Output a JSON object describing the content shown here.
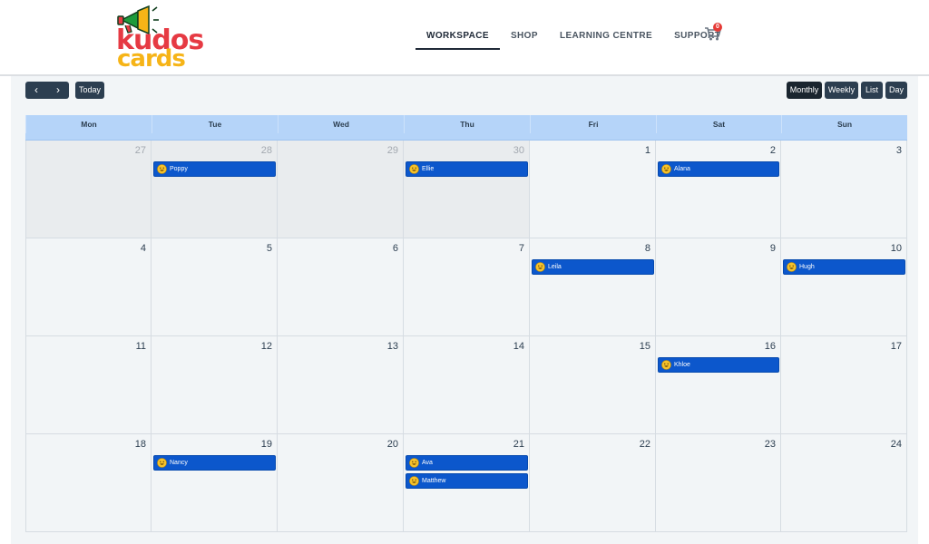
{
  "brand": {
    "logo_text_line1": "kudos",
    "logo_text_line2": "cards",
    "colors": {
      "red": "#e63a43",
      "yellow": "#f6b417",
      "green": "#1e9b3b"
    }
  },
  "nav": [
    {
      "label": "WORKSPACE",
      "active": true
    },
    {
      "label": "SHOP",
      "active": false
    },
    {
      "label": "LEARNING CENTRE",
      "active": false
    },
    {
      "label": "SUPPORT",
      "active": false
    }
  ],
  "cart": {
    "icon": "shopping-cart-icon",
    "count": "0"
  },
  "toolbar": {
    "prev_icon": "‹",
    "next_icon": "›",
    "today_label": "Today",
    "views": [
      {
        "label": "Monthly",
        "active": true
      },
      {
        "label": "Weekly",
        "active": false
      },
      {
        "label": "List",
        "active": false
      },
      {
        "label": "Day",
        "active": false
      }
    ]
  },
  "calendar": {
    "weekdays": [
      "Mon",
      "Tue",
      "Wed",
      "Thu",
      "Fri",
      "Sat",
      "Sun"
    ],
    "weeks": [
      [
        "27",
        "28",
        "29",
        "30",
        "1",
        "2",
        "3"
      ],
      [
        "4",
        "5",
        "6",
        "7",
        "8",
        "9",
        "10"
      ],
      [
        "11",
        "12",
        "13",
        "14",
        "15",
        "16",
        "17"
      ],
      [
        "18",
        "19",
        "20",
        "21",
        "22",
        "23",
        "24"
      ]
    ],
    "other_month_first_row": 4,
    "events": [
      {
        "week": 0,
        "day": 1,
        "slot": 0,
        "label": "Poppy"
      },
      {
        "week": 0,
        "day": 3,
        "slot": 0,
        "label": "Ellie"
      },
      {
        "week": 0,
        "day": 5,
        "slot": 0,
        "label": "Alana"
      },
      {
        "week": 1,
        "day": 4,
        "slot": 0,
        "label": "Leila"
      },
      {
        "week": 1,
        "day": 6,
        "slot": 0,
        "label": "Hugh"
      },
      {
        "week": 2,
        "day": 5,
        "slot": 0,
        "label": "Khloe"
      },
      {
        "week": 3,
        "day": 1,
        "slot": 0,
        "label": "Nancy"
      },
      {
        "week": 3,
        "day": 3,
        "slot": 0,
        "label": "Ava"
      },
      {
        "week": 3,
        "day": 3,
        "slot": 1,
        "label": "Matthew"
      }
    ],
    "event_icon": "smiley-face-icon",
    "event_color": "#0c57cc"
  }
}
